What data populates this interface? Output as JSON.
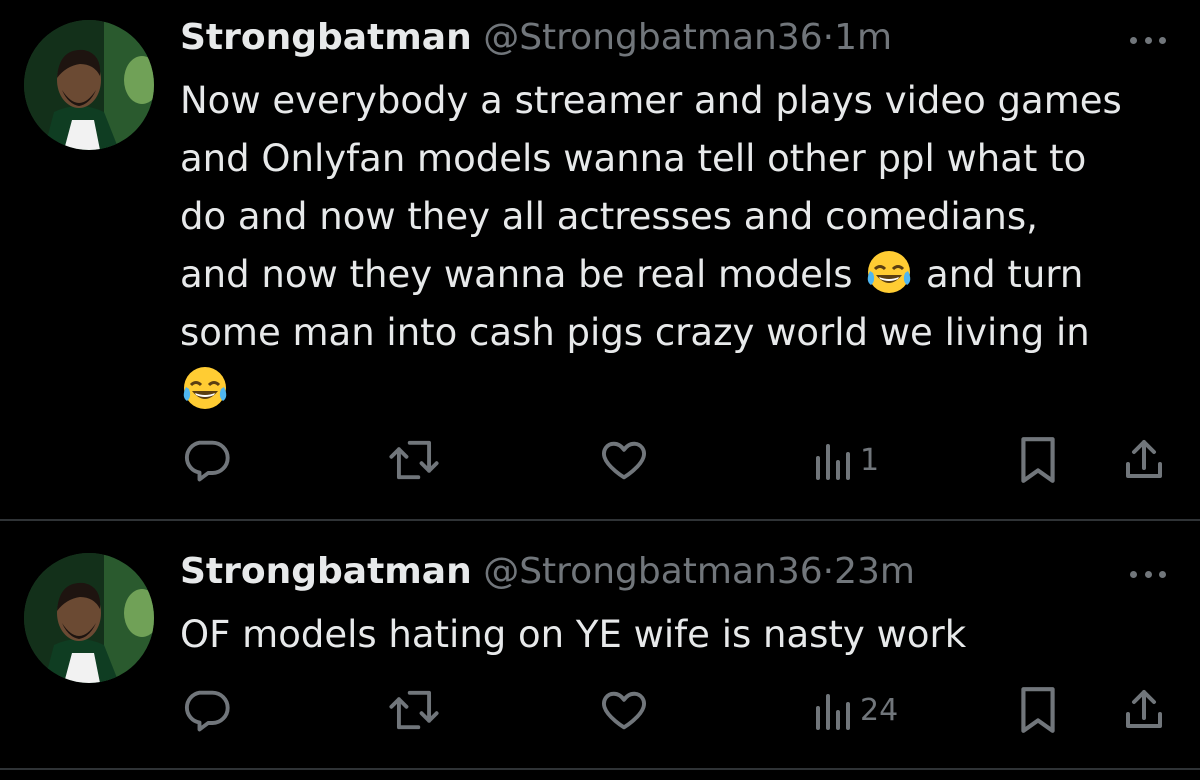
{
  "tweets": [
    {
      "name": "Strongbatman",
      "handle": "@Strongbatman36",
      "separator": "·",
      "time": "1m",
      "text_lines": [
        "Now everybody a streamer and plays video games",
        "and Onlyfan models wanna tell other ppl what to",
        "do and now they all actresses and comedians,",
        "and now they wanna be real models",
        "and turn",
        "some man into cash pigs crazy world we living in"
      ],
      "emoji": "face-with-tears-of-joy",
      "views": "1"
    },
    {
      "name": "Strongbatman",
      "handle": "@Strongbatman36",
      "separator": "·",
      "time": "23m",
      "text": "OF models hating on YE wife is nasty work",
      "views": "24"
    }
  ],
  "icons": {
    "reply": "reply-icon",
    "retweet": "retweet-icon",
    "like": "like-icon",
    "views": "views-icon",
    "bookmark": "bookmark-icon",
    "share": "share-icon",
    "more": "more-icon"
  },
  "colors": {
    "background": "#000000",
    "text": "#e7e9ea",
    "muted": "#71767b",
    "divider": "#2f3336"
  }
}
